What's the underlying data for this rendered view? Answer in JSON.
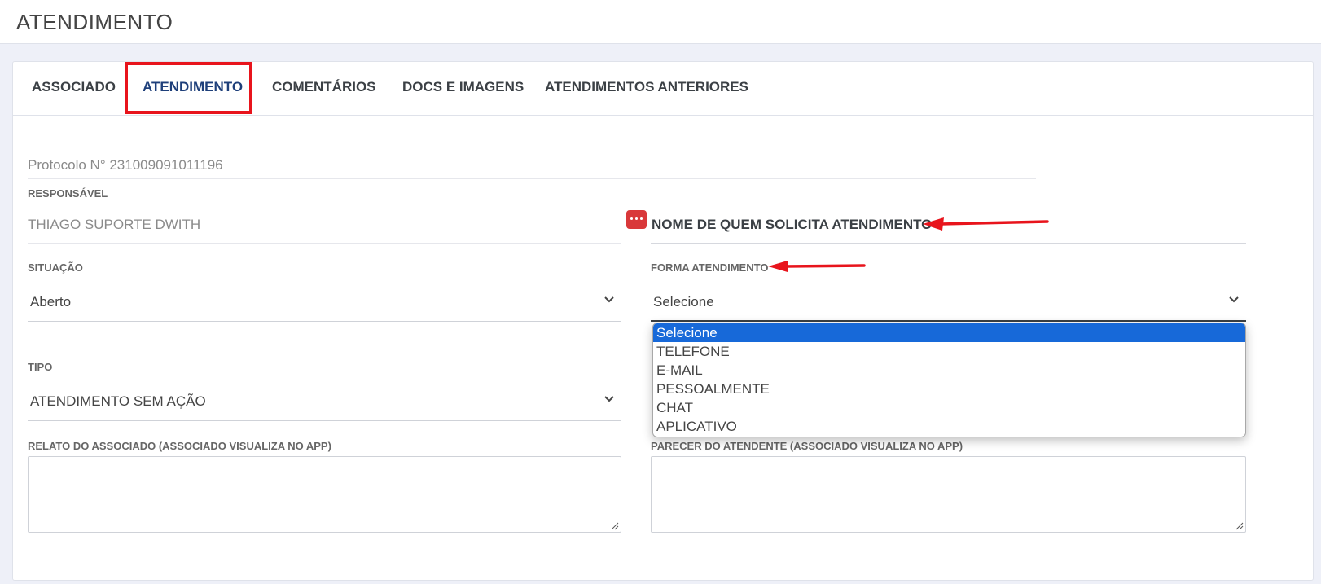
{
  "header": {
    "title": "ATENDIMENTO"
  },
  "tabs": [
    {
      "label": "ASSOCIADO"
    },
    {
      "label": "ATENDIMENTO"
    },
    {
      "label": "COMENTÁRIOS"
    },
    {
      "label": "DOCS E IMAGENS"
    },
    {
      "label": "ATENDIMENTOS ANTERIORES"
    }
  ],
  "active_tab": "ATENDIMENTO",
  "protocol": {
    "text": "Protocolo N° 231009091011196"
  },
  "responsavel": {
    "label": "RESPONSÁVEL",
    "value": "THIAGO SUPORTE DWITH"
  },
  "solicitante": {
    "title": "NOME DE QUEM SOLICITA ATENDIMENTO"
  },
  "situacao": {
    "label": "SITUAÇÃO",
    "value": "Aberto"
  },
  "forma_atendimento": {
    "label": "FORMA ATENDIMENTO",
    "value": "Selecione",
    "options": [
      "Selecione",
      "TELEFONE",
      "E-MAIL",
      "PESSOALMENTE",
      "CHAT",
      "APLICATIVO"
    ],
    "selected_option": "Selecione"
  },
  "tipo": {
    "label": "TIPO",
    "value": "ATENDIMENTO SEM AÇÃO"
  },
  "relato": {
    "label": "RELATO DO ASSOCIADO (ASSOCIADO VISUALIZA NO APP)",
    "value": ""
  },
  "parecer": {
    "label": "PARECER DO ATENDENTE (ASSOCIADO VISUALIZA NO APP)",
    "value": ""
  },
  "colors": {
    "highlight_red": "#e8141c",
    "active_tab_text": "#1e3f7a",
    "dropdown_selected_bg": "#1769d9",
    "icon_red": "#d9383a"
  },
  "icons": {
    "password_icon": "dots-icon",
    "chevron": "chevron-down-icon"
  }
}
